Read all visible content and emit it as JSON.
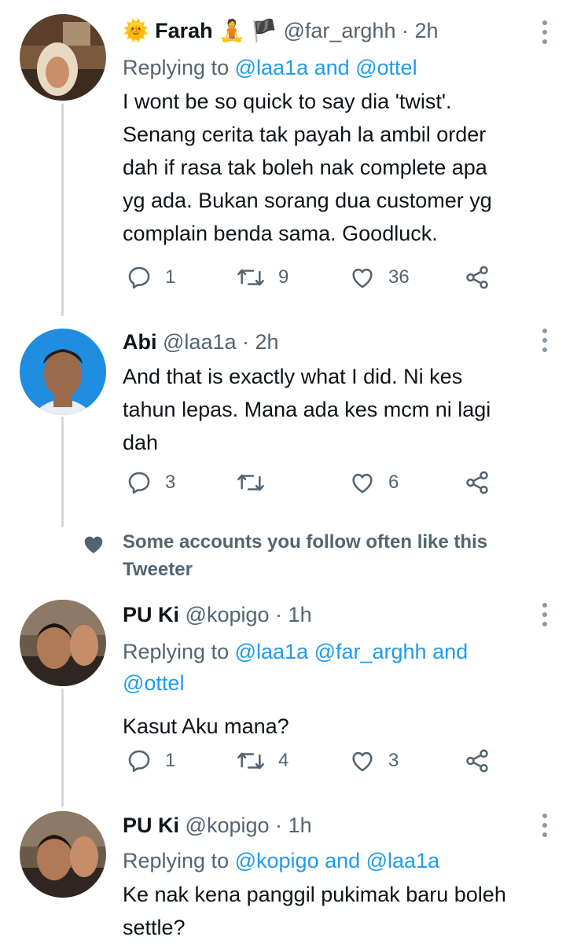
{
  "tweets": [
    {
      "name": "Farah",
      "name_emoji": "🌞",
      "badges": [
        "🧘",
        "🏴"
      ],
      "handle": "@far_arghh",
      "time": "2h",
      "replying_prefix": "Replying to",
      "mentions_line1": "@laa1a and @ottel",
      "text_lines": [
        "I wont be so quick to say dia 'twist'.",
        "Senang cerita tak payah la ambil order",
        "dah if rasa tak boleh nak complete apa",
        "yg ada. Bukan sorang dua customer yg",
        "complain benda sama. Goodluck."
      ],
      "replies": "1",
      "retweets": "9",
      "likes": "36"
    },
    {
      "name": "Abi",
      "handle": "@laa1a",
      "time": "2h",
      "text_lines": [
        "And that is exactly what I did. Ni kes",
        "tahun lepas. Mana ada kes mcm ni lagi",
        "dah"
      ],
      "replies": "3",
      "retweets": "",
      "likes": "6"
    },
    {
      "name": "PU Ki",
      "handle": "@kopigo",
      "time": "1h",
      "replying_prefix": "Replying to",
      "mentions_line1": "@laa1a @far_arghh and",
      "mentions_line2": "@ottel",
      "text_lines": [
        "Kasut Aku mana?"
      ],
      "replies": "1",
      "retweets": "4",
      "likes": "3"
    },
    {
      "name": "PU Ki",
      "handle": "@kopigo",
      "time": "1h",
      "replying_prefix": "Replying to",
      "mentions_line1": "@kopigo and @laa1a",
      "text_lines": [
        "Ke nak kena panggil pukimak baru boleh",
        "settle?"
      ]
    }
  ],
  "social_context": {
    "line1": "Some accounts you follow often like this",
    "line2": "Tweeter",
    "icon": "heart-icon"
  },
  "separator_dot": "·",
  "colors": {
    "link": "#1d9bf0",
    "secondary": "#536471",
    "thread_line": "#cfd9de"
  }
}
